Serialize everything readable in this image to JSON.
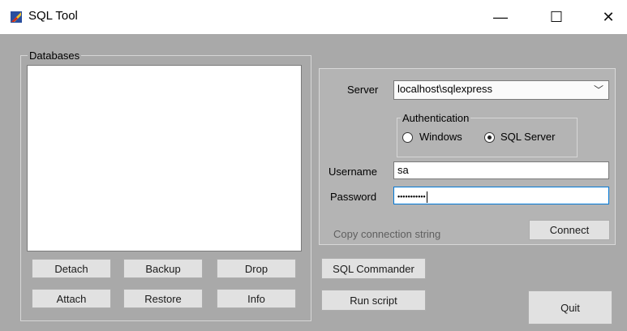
{
  "window": {
    "title": "SQL Tool",
    "minimize": "—",
    "maximize": "☐",
    "close": "✕"
  },
  "databases": {
    "group_label": "Databases",
    "items": []
  },
  "buttons": {
    "detach": "Detach",
    "backup": "Backup",
    "drop": "Drop",
    "attach": "Attach",
    "restore": "Restore",
    "info": "Info",
    "sql_commander": "SQL Commander",
    "run_script": "Run script",
    "quit": "Quit",
    "connect": "Connect"
  },
  "connection": {
    "server_label": "Server",
    "server_value": "localhost\\sqlexpress",
    "auth_group_label": "Authentication",
    "auth_windows": "Windows",
    "auth_sql": "SQL Server",
    "auth_selected": "SQL Server",
    "username_label": "Username",
    "username_value": "sa",
    "password_label": "Password",
    "password_value": "•••••••••••",
    "copy_link": "Copy connection string"
  },
  "colors": {
    "client_bg": "#a9a9a9",
    "panel_bg": "#b4b4b4",
    "focus_border": "#0078d7"
  }
}
